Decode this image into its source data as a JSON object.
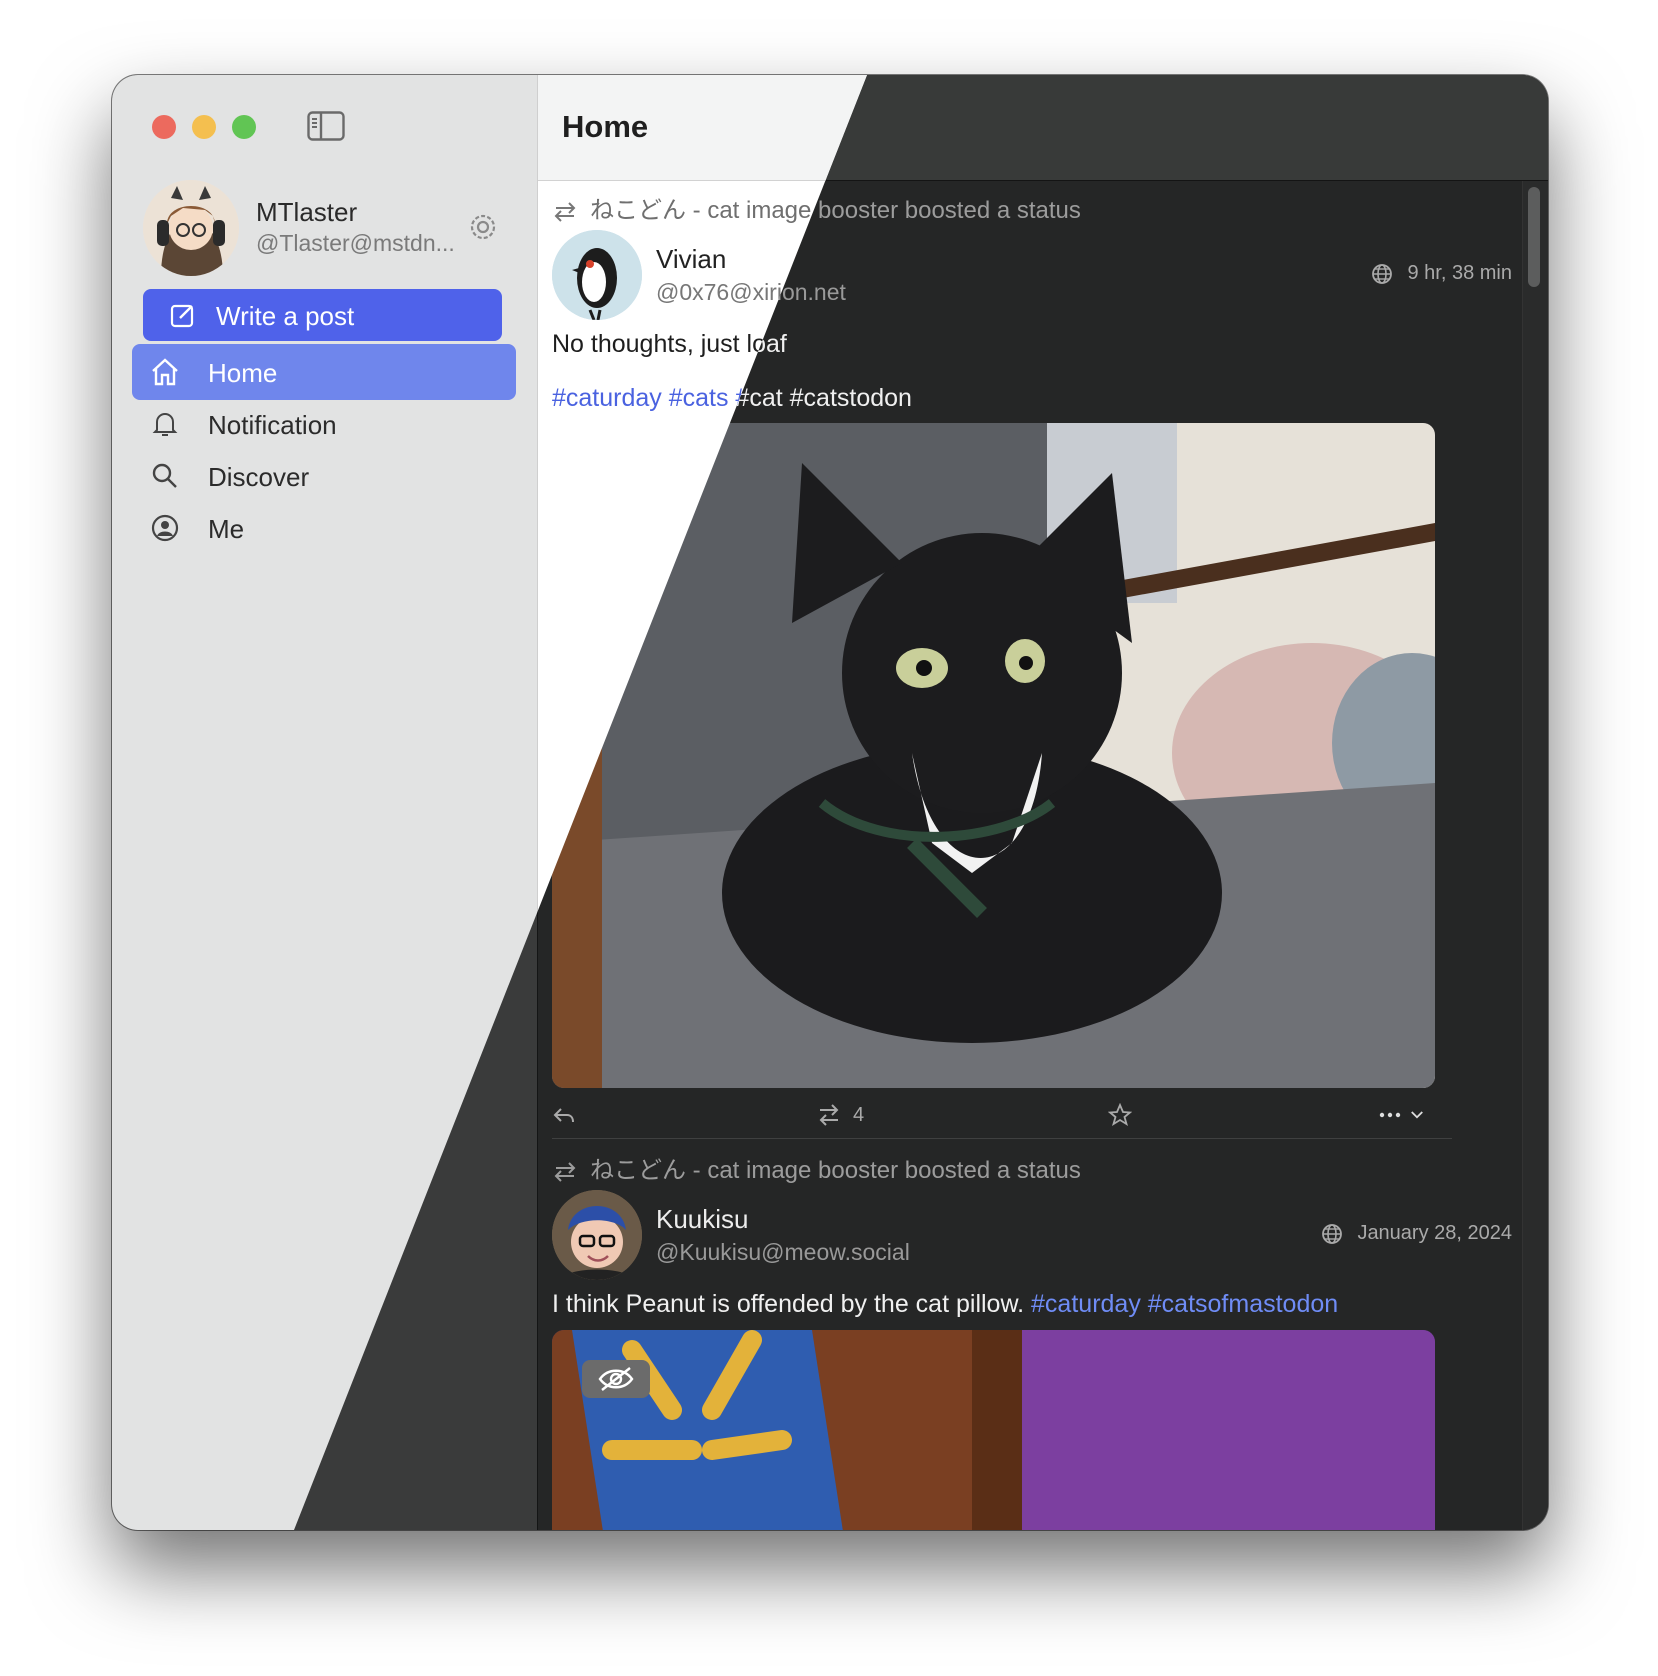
{
  "app": {
    "title": "Home",
    "sidebar_toggle_icon": "sidebar-toggle-icon"
  },
  "account": {
    "display_name": "MTlaster",
    "handle": "@Tlaster@mstdn...",
    "settings_icon": "gear-icon"
  },
  "compose": {
    "label": "Write a post",
    "icon": "compose-icon"
  },
  "nav": {
    "items": [
      {
        "label": "Home",
        "icon": "home-icon",
        "active": true
      },
      {
        "label": "Notification",
        "icon": "bell-icon",
        "active": false
      },
      {
        "label": "Discover",
        "icon": "search-icon",
        "active": false
      },
      {
        "label": "Me",
        "icon": "person-circle-icon",
        "active": false
      }
    ]
  },
  "feed": {
    "posts": [
      {
        "boost_text": "ねこどん - cat image booster boosted a status",
        "author_name": "Vivian",
        "author_handle": "@0x76@xirion.net",
        "time": "9 hr, 38 min",
        "visibility_icon": "globe-icon",
        "text": "No thoughts, just loaf",
        "tags": "#caturday #cats #cat #catstodon",
        "reblog_count": "4"
      },
      {
        "boost_text": "ねこどん - cat image booster boosted a status",
        "author_name": "Kuukisu",
        "author_handle": "@Kuukisu@meow.social",
        "time": "January 28, 2024",
        "visibility_icon": "globe-icon",
        "text": "I think Peanut is offended by the cat pillow. ",
        "tags": "#caturday #catsofmastodon"
      }
    ]
  },
  "colors": {
    "accent": "#4f62ea",
    "nav_active": "#6f86ec",
    "hashtag": "#6f8cf5"
  }
}
